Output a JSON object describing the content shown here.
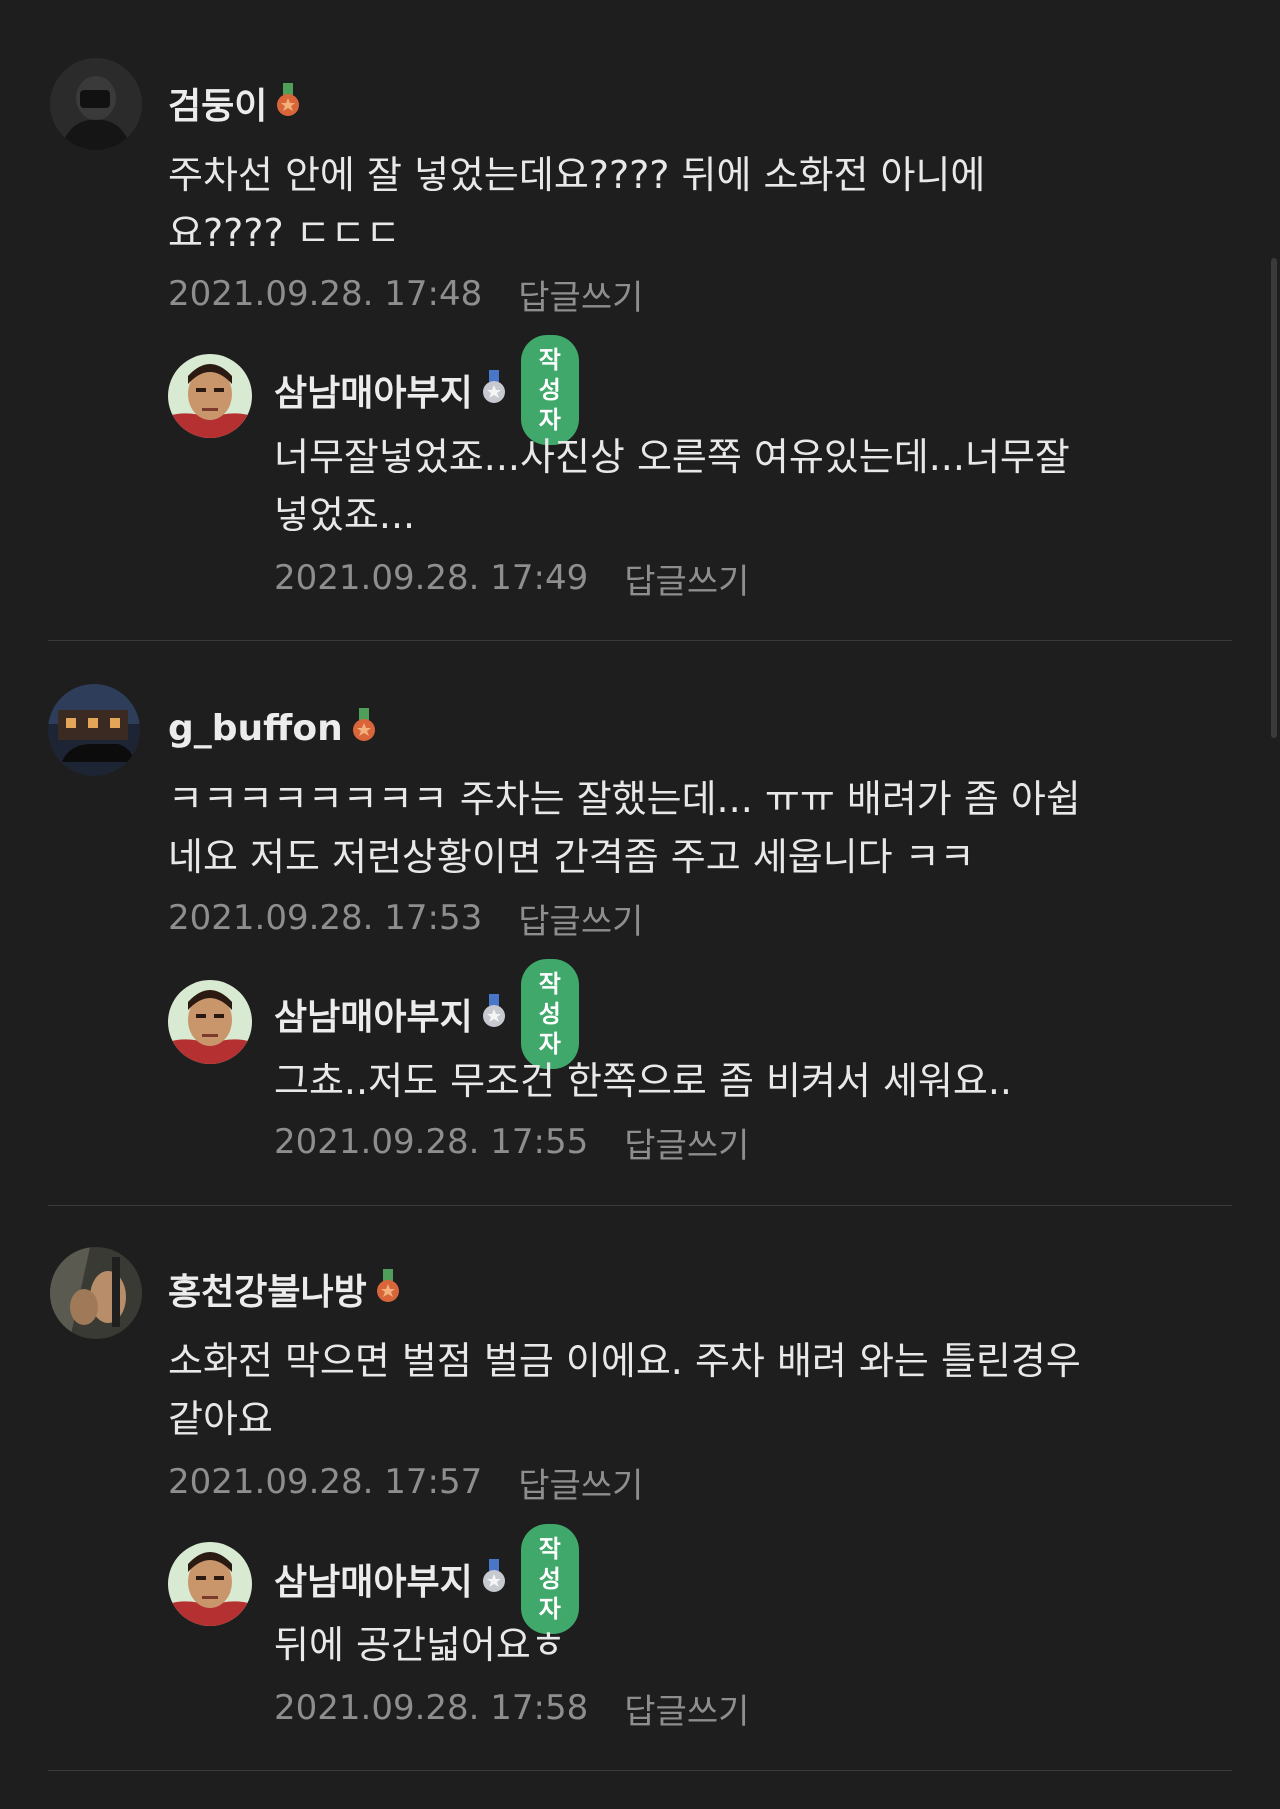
{
  "badge_color": "#3fa86a",
  "comments": [
    {
      "nickname": "검둥이",
      "medal": "bronze-medal-icon",
      "text": "주차선 안에 잘 넣었는데요???? 뒤에 소화전 아니에\n요???? ㄷㄷㄷ",
      "timestamp": "2021.09.28. 17:48",
      "reply_label": "답글쓰기",
      "reply": {
        "nickname": "삼남매아부지",
        "medal": "silver-medal-icon",
        "author_badge": "작성자",
        "text": "너무잘넣었죠...사진상 오른쪽 여유있는데...너무잘\n넣었죠...",
        "timestamp": "2021.09.28. 17:49",
        "reply_label": "답글쓰기"
      }
    },
    {
      "nickname": "g_buffon",
      "medal": "bronze-medal-icon",
      "text": "ㅋㅋㅋㅋㅋㅋㅋㅋ 주차는 잘했는데... ㅠㅠ 배려가 좀 아쉽\n네요 저도 저런상황이면 간격좀 주고 세웁니다 ㅋㅋ",
      "timestamp": "2021.09.28. 17:53",
      "reply_label": "답글쓰기",
      "reply": {
        "nickname": "삼남매아부지",
        "medal": "silver-medal-icon",
        "author_badge": "작성자",
        "text": "그쵸..저도 무조건 한쪽으로 좀 비켜서 세워요..",
        "timestamp": "2021.09.28. 17:55",
        "reply_label": "답글쓰기"
      }
    },
    {
      "nickname": "홍천강불나방",
      "medal": "bronze-medal-icon",
      "text": "소화전 막으면 벌점 벌금 이에요. 주차 배려 와는 틀린경우\n같아요",
      "timestamp": "2021.09.28. 17:57",
      "reply_label": "답글쓰기",
      "reply": {
        "nickname": "삼남매아부지",
        "medal": "silver-medal-icon",
        "author_badge": "작성자",
        "text": "뒤에 공간넓어요ㅎ",
        "timestamp": "2021.09.28. 17:58",
        "reply_label": "답글쓰기"
      }
    }
  ]
}
